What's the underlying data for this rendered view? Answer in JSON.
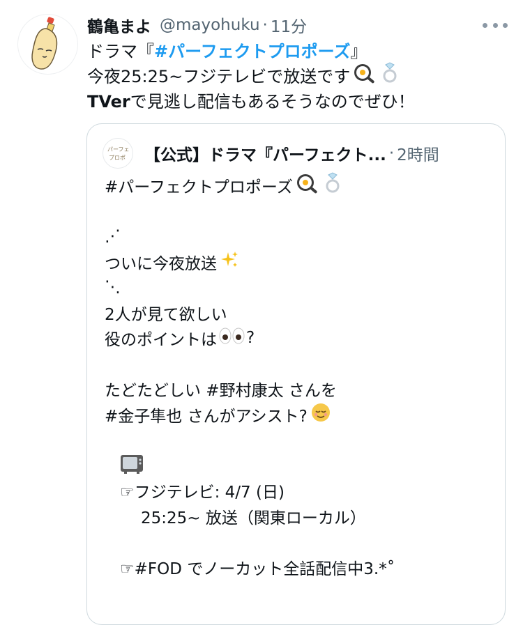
{
  "tweet": {
    "author_name": "鶴亀まよ",
    "handle": "@mayohuku",
    "separator": "·",
    "time": "11分",
    "line1_prefix": "ドラマ『",
    "line1_hashtag": "#パーフェクトプロポーズ",
    "line1_suffix": "』",
    "line2": "今夜25:25~フジテレビで放送です",
    "line3_bold": "TVer",
    "line3_rest": " で見逃し配信もあるそうなのでぜひ！"
  },
  "quote": {
    "author_name": "【公式】ドラマ『パーフェクト...",
    "separator": "·",
    "time": "2時間",
    "lines": [
      "#パーフェクトプロポーズ",
      "",
      "⋰",
      "ついに今夜放送",
      "⋱",
      "2人が見て欲しい",
      "役のポイントは",
      "",
      "たどたどしい #野村康太 さんを",
      "#金子隼也 さんがアシスト?",
      "",
      "",
      "☞フジテレビ: 4/7 (日)",
      "25:25~ 放送（関東ローカル）",
      "",
      "☞#FOD でノーカット全話配信中3.*˚"
    ],
    "eyes_suffix": "?"
  },
  "icons": [
    "more-icon",
    "avatar-mayonnaise-icon",
    "frying-pan-egg-icon",
    "ring-icon",
    "sparkles-icon",
    "eyes-icon",
    "relieved-face-icon",
    "television-icon"
  ],
  "colors": {
    "link": "#1d9bf0",
    "secondary": "#536471",
    "border": "#cfd9de"
  }
}
